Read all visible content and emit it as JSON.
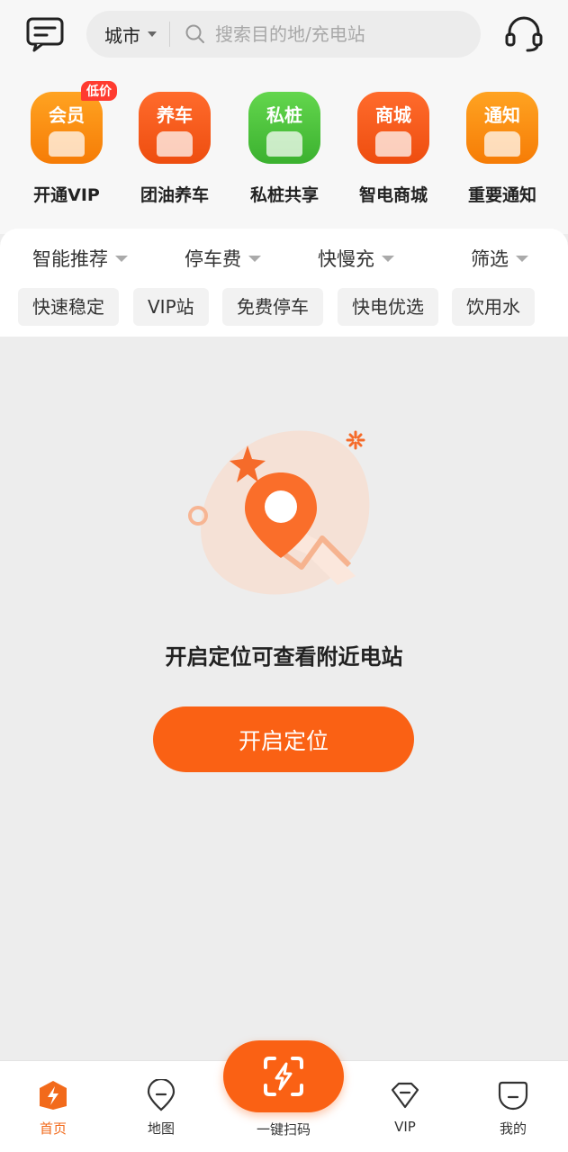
{
  "colors": {
    "accent": "#fa6114",
    "active_tab": "#f26a1b",
    "badge": "#ff3b30"
  },
  "header": {
    "city_label": "城市",
    "search_placeholder": "搜索目的地/充电站",
    "icons": {
      "message": "message-icon",
      "support": "headset-icon",
      "search": "search-icon"
    }
  },
  "quick_actions": [
    {
      "icon_text": "会员",
      "label": "开通VIP",
      "badge": "低价",
      "color": "#fb8c0f"
    },
    {
      "icon_text": "养车",
      "label": "团油养车",
      "color": "#f25c1e"
    },
    {
      "icon_text": "私桩",
      "label": "私桩共享",
      "color": "#4cc33f"
    },
    {
      "icon_text": "商城",
      "label": "智电商城",
      "color": "#f25c1e"
    },
    {
      "icon_text": "通知",
      "label": "重要通知",
      "color": "#fb8c0f"
    }
  ],
  "filters": {
    "sort_options": [
      "智能推荐",
      "停车费",
      "快慢充",
      "筛选"
    ],
    "tags": [
      "快速稳定",
      "VIP站",
      "免费停车",
      "快电优选",
      "饮用水"
    ]
  },
  "empty_state": {
    "title": "开启定位可查看附近电站",
    "button_label": "开启定位",
    "illustration": "location-pin-illustration"
  },
  "tabbar": {
    "items": [
      {
        "label": "首页",
        "active": true,
        "icon": "bolt-home-icon"
      },
      {
        "label": "地图",
        "active": false,
        "icon": "map-pin-icon"
      },
      {
        "label": "一键扫码",
        "active": false,
        "icon": "scan-bolt-icon"
      },
      {
        "label": "VIP",
        "active": false,
        "icon": "vip-diamond-icon"
      },
      {
        "label": "我的",
        "active": false,
        "icon": "profile-icon"
      }
    ]
  }
}
